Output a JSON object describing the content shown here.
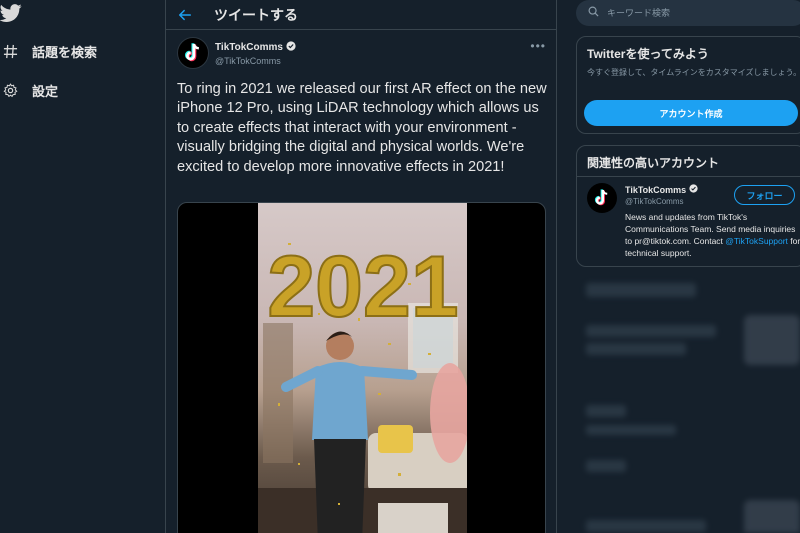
{
  "nav": {
    "items": [
      {
        "label": "話題を検索",
        "icon": "hashtag-icon"
      },
      {
        "label": "設定",
        "icon": "gear-icon"
      }
    ]
  },
  "header": {
    "title": "ツイートする"
  },
  "tweet": {
    "display_name": "TikTokComms",
    "handle": "@TikTokComms",
    "text": "To ring in 2021 we released our first AR effect on the new iPhone 12 Pro, using LiDAR technology which allows us to create effects that interact with your environment - visually bridging the digital and physical worlds. We're excited to develop more innovative effects in 2021!",
    "media_overlay": "2021"
  },
  "search": {
    "placeholder": "キーワード検索"
  },
  "signup_card": {
    "title": "Twitterを使ってみよう",
    "subtitle": "今すぐ登録して、タイムラインをカスタマイズしましょう。",
    "button": "アカウント作成"
  },
  "related_card": {
    "title": "関連性の高いアカウント",
    "display_name": "TikTokComms",
    "handle": "@TikTokComms",
    "follow_button": "フォロー",
    "bio_before": "News and updates from TikTok's Communications Team. Send media inquiries to pr@tiktok.com. Contact ",
    "bio_mention": "@TikTokSupport",
    "bio_after": " for technical support."
  },
  "colors": {
    "background": "#15202b",
    "accent": "#1da1f2",
    "border": "#38444d",
    "muted": "#8899a6"
  }
}
